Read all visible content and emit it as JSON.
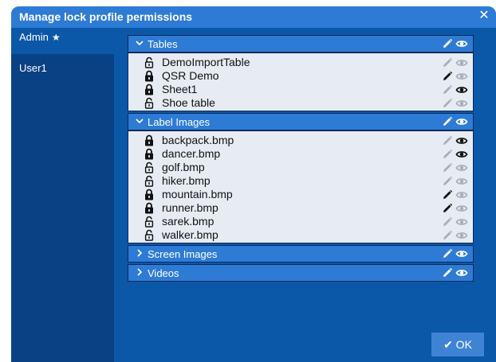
{
  "dialog": {
    "title": "Manage lock profile permissions",
    "close_glyph": "✕"
  },
  "sidebar": {
    "items": [
      {
        "label": "Admin",
        "starred": true
      },
      {
        "label": "User1",
        "starred": false
      }
    ],
    "star_glyph": "★"
  },
  "sections": [
    {
      "label": "Tables",
      "expanded": true,
      "items": [
        {
          "name": "DemoImportTable",
          "locked": false,
          "edit": false,
          "view": false
        },
        {
          "name": "QSR Demo",
          "locked": true,
          "edit": true,
          "view": false
        },
        {
          "name": "Sheet1",
          "locked": true,
          "edit": false,
          "view": true
        },
        {
          "name": "Shoe table",
          "locked": false,
          "edit": false,
          "view": false
        }
      ]
    },
    {
      "label": "Label Images",
      "expanded": true,
      "items": [
        {
          "name": "backpack.bmp",
          "locked": true,
          "edit": false,
          "view": true
        },
        {
          "name": "dancer.bmp",
          "locked": true,
          "edit": false,
          "view": true
        },
        {
          "name": "golf.bmp",
          "locked": false,
          "edit": false,
          "view": false
        },
        {
          "name": "hiker.bmp",
          "locked": false,
          "edit": false,
          "view": false
        },
        {
          "name": "mountain.bmp",
          "locked": true,
          "edit": true,
          "view": false
        },
        {
          "name": "runner.bmp",
          "locked": true,
          "edit": true,
          "view": false
        },
        {
          "name": "sarek.bmp",
          "locked": false,
          "edit": false,
          "view": false
        },
        {
          "name": "walker.bmp",
          "locked": false,
          "edit": false,
          "view": false
        }
      ]
    },
    {
      "label": "Screen Images",
      "expanded": false,
      "items": []
    },
    {
      "label": "Videos",
      "expanded": false,
      "items": []
    }
  ],
  "footer": {
    "ok_label": "✔ OK"
  },
  "colors": {
    "active_icon": "#111111",
    "inactive_icon": "#a8afba",
    "header_icon": "#ffffff",
    "accent": "#2e7bd6",
    "background": "#0b57a8"
  },
  "icons": {
    "edit": "pencil-icon",
    "view": "eye-icon",
    "locked": "lock-closed-icon",
    "unlocked": "lock-open-icon",
    "expand": "chevron-right-icon",
    "collapse": "chevron-down-icon"
  }
}
